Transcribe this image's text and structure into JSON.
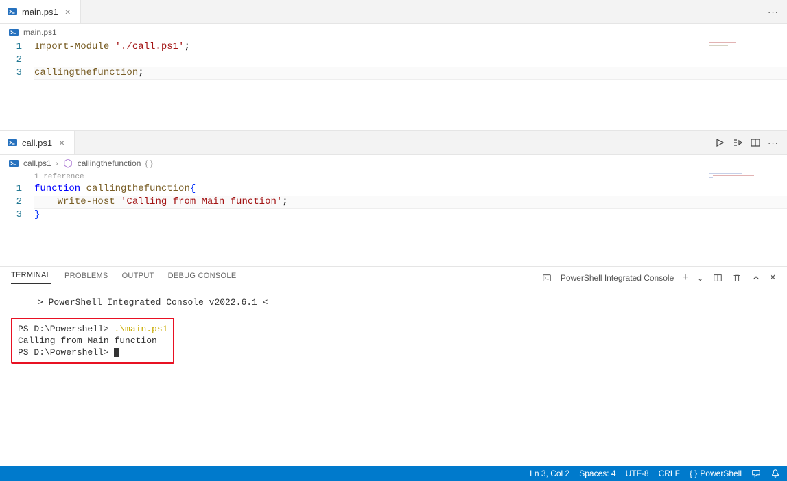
{
  "editor1": {
    "tab": {
      "filename": "main.ps1"
    },
    "breadcrumb": {
      "filename": "main.ps1"
    },
    "lines": {
      "l1_kw": "Import-Module",
      "l1_str": "'./call.ps1'",
      "l1_semi": ";",
      "l3_fn": "callingthefunction",
      "l3_semi": ";"
    },
    "line_numbers": [
      "1",
      "2",
      "3"
    ]
  },
  "editor2": {
    "tab": {
      "filename": "call.ps1"
    },
    "breadcrumb": {
      "filename": "call.ps1",
      "symbol": "callingthefunction",
      "suffix": "{ }"
    },
    "codelens": "1 reference",
    "lines": {
      "l1_kw": "function",
      "l1_name": "callingthefunction",
      "l1_brace": "{",
      "l2_indent": "    ",
      "l2_cmd": "Write-Host",
      "l2_str": "'Calling from Main function'",
      "l2_semi": ";",
      "l3_brace": "}"
    },
    "line_numbers": [
      "1",
      "2",
      "3"
    ]
  },
  "panel": {
    "tabs": {
      "terminal": "TERMINAL",
      "problems": "PROBLEMS",
      "output": "OUTPUT",
      "debug": "DEBUG CONSOLE"
    },
    "terminal_name": "PowerShell Integrated Console",
    "content": {
      "banner": "=====> PowerShell Integrated Console v2022.6.1 <=====",
      "prompt1": "PS D:\\Powershell> ",
      "cmd1": ".\\main.ps1",
      "out1": "Calling from Main function",
      "prompt2": "PS D:\\Powershell> "
    }
  },
  "statusbar": {
    "ln_col": "Ln 3, Col 2",
    "spaces": "Spaces: 4",
    "encoding": "UTF-8",
    "eol": "CRLF",
    "lang": "PowerShell",
    "lang_prefix": "{ }"
  },
  "icons": {
    "close": "×",
    "more": "···",
    "chevron": "›",
    "plus": "+",
    "dropdown": "⌄",
    "trash": "🗑",
    "up": "^",
    "x": "×",
    "bell": "🔔"
  }
}
